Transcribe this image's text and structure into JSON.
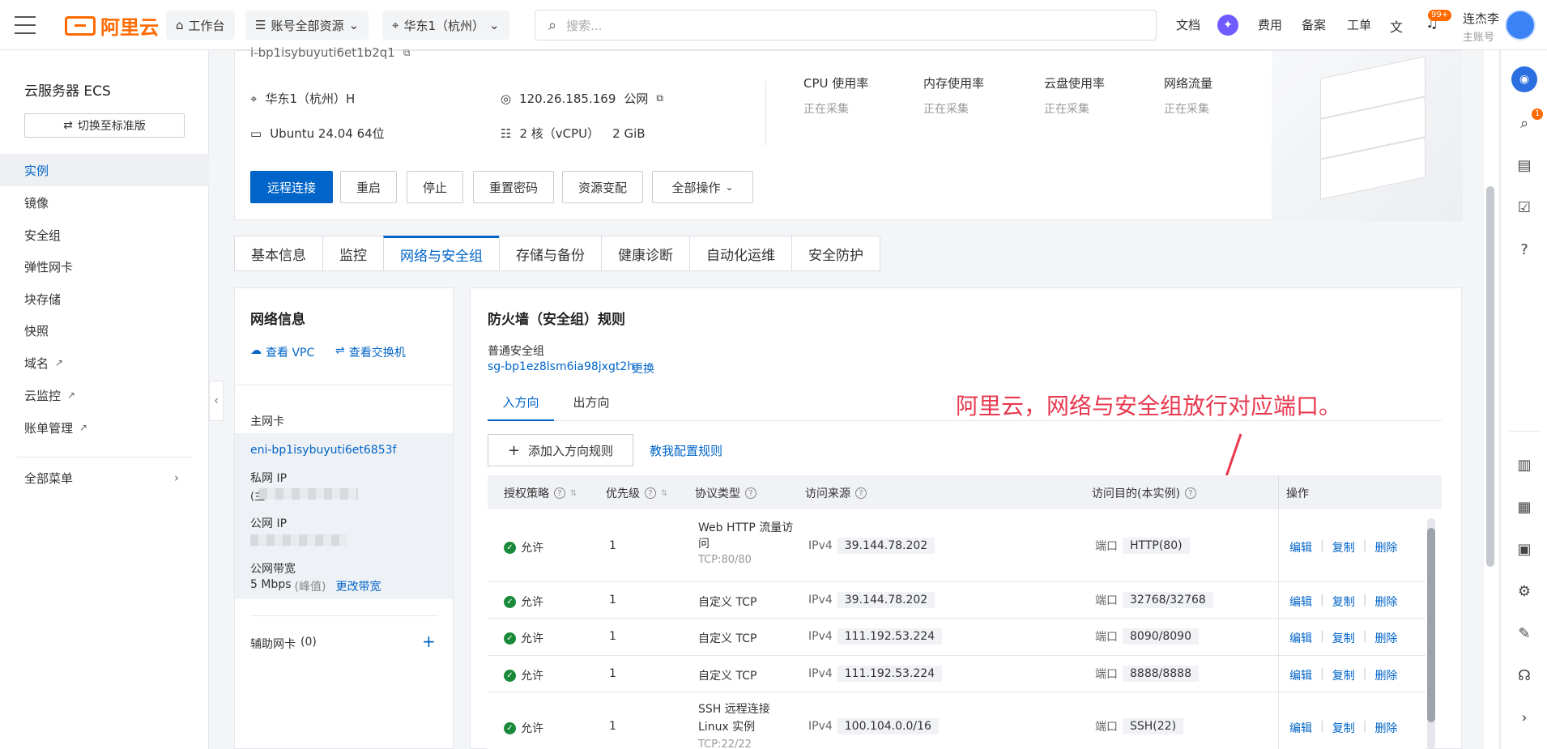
{
  "topbar": {
    "logo_text": "阿里云",
    "workbench": "工作台",
    "resource_scope": "账号全部资源",
    "region": "华东1（杭州）",
    "search_placeholder": "搜索...",
    "links": [
      "文档",
      "费用",
      "备案",
      "工单"
    ],
    "notify_badge": "99+",
    "user_name": "连杰李",
    "user_role": "主账号"
  },
  "sidebar": {
    "title": "云服务器 ECS",
    "switch_label": "切换至标准版",
    "items": [
      {
        "label": "实例",
        "active": true
      },
      {
        "label": "镜像"
      },
      {
        "label": "安全组"
      },
      {
        "label": "弹性网卡"
      },
      {
        "label": "块存储"
      },
      {
        "label": "快照"
      },
      {
        "label": "域名"
      },
      {
        "label": "云监控"
      },
      {
        "label": "账单管理"
      },
      {
        "label": "全部菜单"
      }
    ]
  },
  "instance": {
    "id": "i-bp1isybuyuti6et1b2q1",
    "zone": "华东1（杭州）H",
    "public_ip": "120.26.185.169",
    "public_ip_tag": "公网",
    "os": "Ubuntu 24.04 64位",
    "cpu": "2 核（vCPU）",
    "mem": "2 GiB",
    "metrics": [
      {
        "label": "CPU 使用率",
        "value": "正在采集"
      },
      {
        "label": "内存使用率",
        "value": "正在采集"
      },
      {
        "label": "云盘使用率",
        "value": "正在采集"
      },
      {
        "label": "网络流量",
        "value": "正在采集"
      }
    ],
    "actions": [
      "远程连接",
      "重启",
      "停止",
      "重置密码",
      "资源变配",
      "全部操作"
    ]
  },
  "tabs": [
    "基本信息",
    "监控",
    "网络与安全组",
    "存储与备份",
    "健康诊断",
    "自动化运维",
    "安全防护"
  ],
  "network_info": {
    "title": "网络信息",
    "view_vpc": "查看 VPC",
    "view_vswitch": "查看交换机",
    "primary_nic_label": "主网卡",
    "eni_id": "eni-bp1isybuyuti6et6853f",
    "private_ip_label": "私网 IP",
    "private_ip_prefix": "(主",
    "public_ip_label": "公网 IP",
    "bandwidth_label": "公网带宽",
    "bandwidth_value": "5 Mbps",
    "bandwidth_peak": "(峰值)",
    "change_bandwidth": "更改带宽",
    "aux_nic_label": "辅助网卡",
    "aux_nic_count": "(0)"
  },
  "firewall": {
    "title": "防火墙（安全组）规则",
    "sg_type": "普通安全组",
    "sg_id": "sg-bp1ez8lsm6ia98jxgt2h",
    "change": "更换",
    "direction_tabs": [
      "入方向",
      "出方向"
    ],
    "add_rule": "添加入方向规则",
    "teach_rule": "教我配置规则",
    "columns": [
      "授权策略",
      "优先级",
      "协议类型",
      "访问来源",
      "访问目的(本实例)",
      "操作"
    ],
    "port_label": "端口",
    "ops": [
      "编辑",
      "复制",
      "删除"
    ],
    "rows": [
      {
        "policy": "允许",
        "priority": "1",
        "protocol": "Web HTTP 流量访问",
        "protocol_sub": "TCP:80/80",
        "ip_ver": "IPv4",
        "source": "39.144.78.202",
        "port": "HTTP(80)"
      },
      {
        "policy": "允许",
        "priority": "1",
        "protocol": "自定义 TCP",
        "protocol_sub": "",
        "ip_ver": "IPv4",
        "source": "39.144.78.202",
        "port": "32768/32768"
      },
      {
        "policy": "允许",
        "priority": "1",
        "protocol": "自定义 TCP",
        "protocol_sub": "",
        "ip_ver": "IPv4",
        "source": "111.192.53.224",
        "port": "8090/8090"
      },
      {
        "policy": "允许",
        "priority": "1",
        "protocol": "自定义 TCP",
        "protocol_sub": "",
        "ip_ver": "IPv4",
        "source": "111.192.53.224",
        "port": "8888/8888"
      },
      {
        "policy": "允许",
        "priority": "1",
        "protocol": "SSH 远程连接 Linux 实例",
        "protocol_sub": "TCP:22/22",
        "ip_ver": "IPv4",
        "source": "100.104.0.0/16",
        "port": "SSH(22)"
      }
    ]
  },
  "annotation": "阿里云，网络与安全组放行对应端口。",
  "colors": {
    "brand": "#ff6a00",
    "primary": "#0064c8",
    "annotation": "#e8384f",
    "allow": "#1a8a3a"
  }
}
